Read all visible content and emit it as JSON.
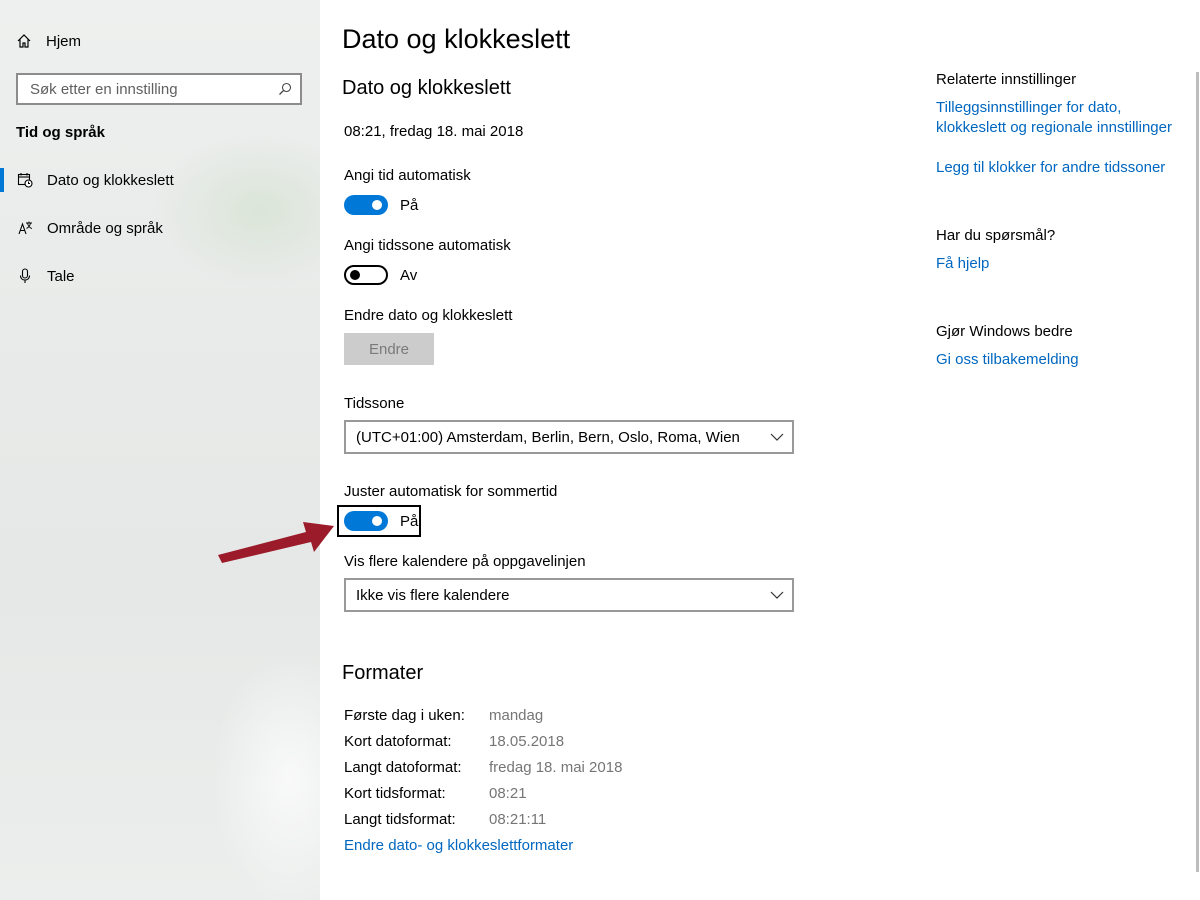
{
  "sidebar": {
    "home_label": "Hjem",
    "search_placeholder": "Søk etter en innstilling",
    "section_title": "Tid og språk",
    "items": [
      {
        "label": "Dato og klokkeslett",
        "icon": "calendar-clock-icon",
        "active": true
      },
      {
        "label": "Område og språk",
        "icon": "language-icon",
        "active": false
      },
      {
        "label": "Tale",
        "icon": "microphone-icon",
        "active": false
      }
    ]
  },
  "main": {
    "page_title": "Dato og klokkeslett",
    "section_title": "Dato og klokkeslett",
    "current_datetime": "08:21, fredag 18. mai 2018",
    "auto_time": {
      "label": "Angi tid automatisk",
      "state": "På",
      "on": true
    },
    "auto_timezone": {
      "label": "Angi tidssone automatisk",
      "state": "Av",
      "on": false
    },
    "change_datetime": {
      "label": "Endre dato og klokkeslett",
      "button": "Endre"
    },
    "timezone": {
      "label": "Tidssone",
      "value": "(UTC+01:00) Amsterdam, Berlin, Bern, Oslo, Roma, Wien"
    },
    "dst": {
      "label": "Juster automatisk for sommertid",
      "state": "På",
      "on": true
    },
    "calendars": {
      "label": "Vis flere kalendere på oppgavelinjen",
      "value": "Ikke vis flere kalendere"
    },
    "formats": {
      "title": "Formater",
      "rows": [
        {
          "key": "Første dag i uken:",
          "value": "mandag"
        },
        {
          "key": "Kort datoformat:",
          "value": "18.05.2018"
        },
        {
          "key": "Langt datoformat:",
          "value": "fredag 18. mai 2018"
        },
        {
          "key": "Kort tidsformat:",
          "value": "08:21"
        },
        {
          "key": "Langt tidsformat:",
          "value": "08:21:11"
        }
      ],
      "change_link": "Endre dato- og klokkeslettformater"
    }
  },
  "related": {
    "title": "Relaterte innstillinger",
    "link1_line1": "Tilleggsinnstillinger for dato,",
    "link1_line2": "klokkeslett og regionale innstillinger",
    "link2": "Legg til klokker for andre tidssoner",
    "questions_title": "Har du spørsmål?",
    "help_link": "Få hjelp",
    "improve_title": "Gjør Windows bedre",
    "feedback_link": "Gi oss tilbakemelding"
  },
  "colors": {
    "accent": "#0078d7",
    "link": "#0067c0",
    "annotation_arrow": "#9b1b2a"
  }
}
